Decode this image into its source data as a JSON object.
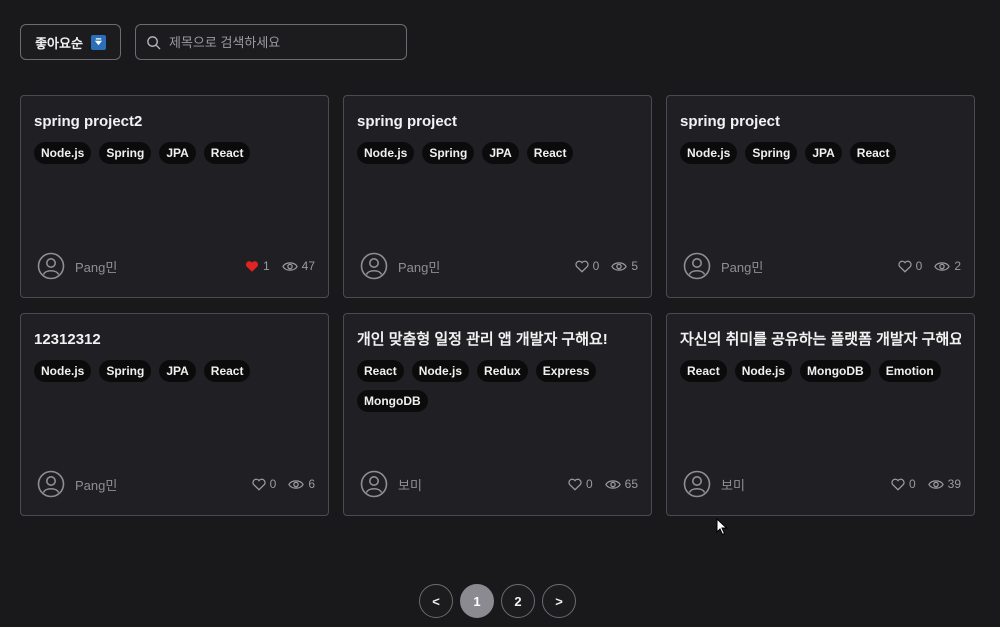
{
  "toolbar": {
    "sort_label": "좋아요순",
    "search_placeholder": "제목으로 검색하세요"
  },
  "colors": {
    "background": "#19191c",
    "card": "#202024",
    "heart_active": "#e02424",
    "sort_icon": "#2a6fb8"
  },
  "cards": [
    {
      "title": "spring project2",
      "tags": [
        "Node.js",
        "Spring",
        "JPA",
        "React"
      ],
      "author": "Pang민",
      "likes": "1",
      "liked": true,
      "views": "47"
    },
    {
      "title": "spring project",
      "tags": [
        "Node.js",
        "Spring",
        "JPA",
        "React"
      ],
      "author": "Pang민",
      "likes": "0",
      "liked": false,
      "views": "5"
    },
    {
      "title": "spring project",
      "tags": [
        "Node.js",
        "Spring",
        "JPA",
        "React"
      ],
      "author": "Pang민",
      "likes": "0",
      "liked": false,
      "views": "2"
    },
    {
      "title": "12312312",
      "tags": [
        "Node.js",
        "Spring",
        "JPA",
        "React"
      ],
      "author": "Pang민",
      "likes": "0",
      "liked": false,
      "views": "6"
    },
    {
      "title": "개인 맞춤형 일정 관리 앱 개발자 구해요!",
      "tags": [
        "React",
        "Node.js",
        "Redux",
        "Express",
        "MongoDB"
      ],
      "author": "보미",
      "likes": "0",
      "liked": false,
      "views": "65"
    },
    {
      "title": "자신의 취미를 공유하는 플랫폼 개발자 구해요!",
      "tags": [
        "React",
        "Node.js",
        "MongoDB",
        "Emotion"
      ],
      "author": "보미",
      "likes": "0",
      "liked": false,
      "views": "39"
    }
  ],
  "pagination": {
    "prev": "<",
    "pages": [
      "1",
      "2"
    ],
    "current": "1",
    "next": ">"
  },
  "icons": {
    "sort": "sort-badge-icon",
    "search": "search-icon",
    "avatar": "user-avatar-icon",
    "like": "heart-icon",
    "views": "eye-icon"
  }
}
